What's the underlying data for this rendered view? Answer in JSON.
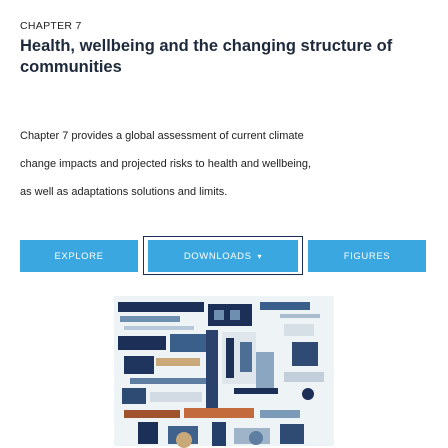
{
  "chapter": {
    "label": "CHAPTER 7",
    "title": "Health, wellbeing and the changing structure of communities",
    "description_lines": [
      "Chapter 7 provides a global assessment of current climate",
      "change impacts and projected risks to health and wellbeing,",
      "as well as adaptations solutions and limits."
    ]
  },
  "buttons": {
    "explore": "EXPLORE",
    "downloads": "DOWNLOADS",
    "downloads_caret": "▾",
    "figures": "FIGURES"
  },
  "colors": {
    "button_bg": "#3aa7e0",
    "selection_border": "#1b2d52",
    "title": "#1e2a3c"
  },
  "illustration": {
    "icon": "chapter-cover-illustration"
  }
}
